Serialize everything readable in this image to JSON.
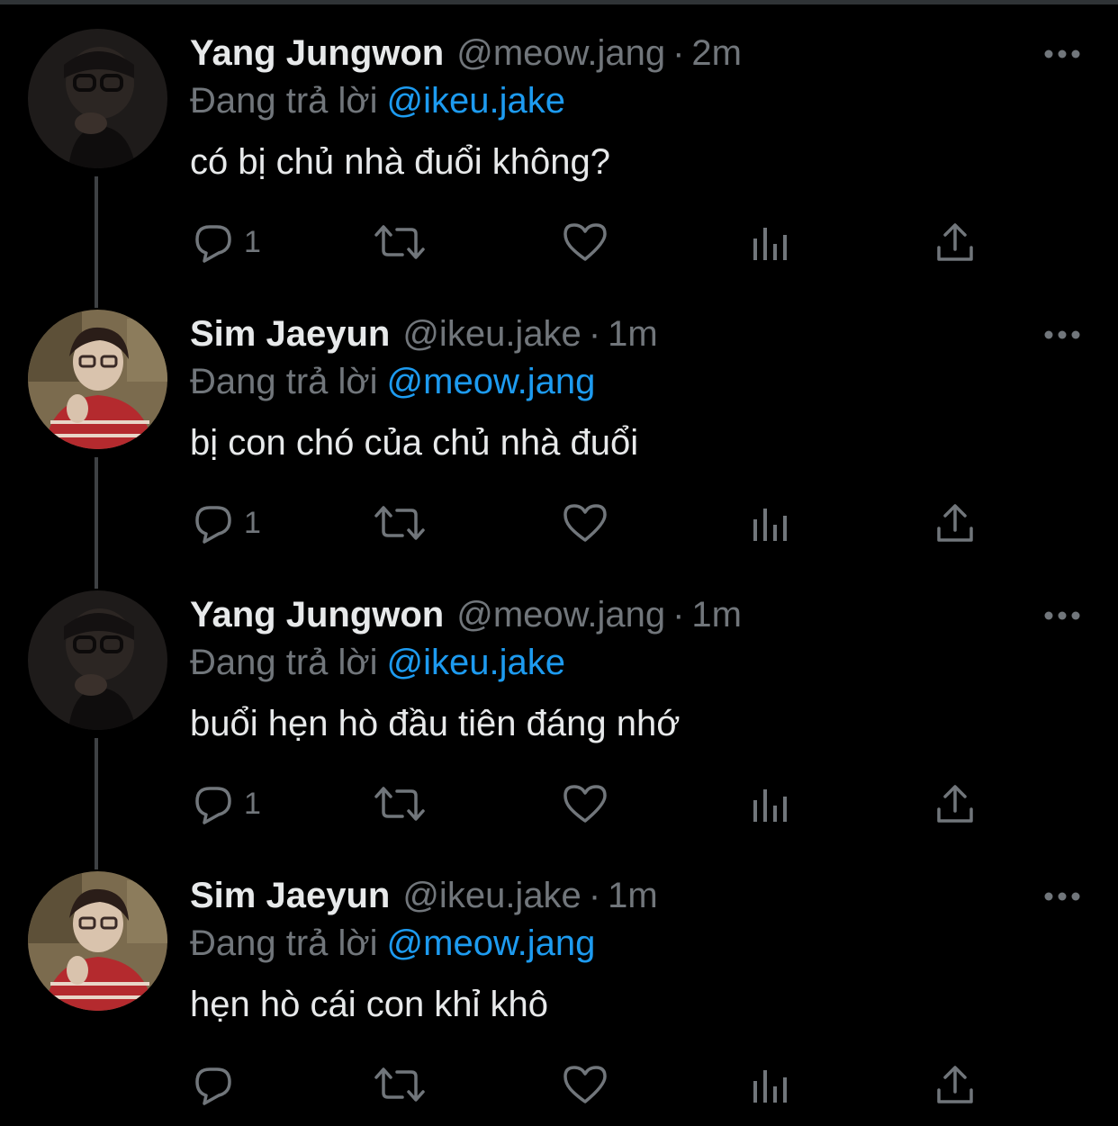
{
  "reply_label": "Đang trả lời",
  "tweets": [
    {
      "name": "Yang Jungwon",
      "handle": "@meow.jang",
      "time": "2m",
      "reply_to": "@ikeu.jake",
      "text": "có bị chủ nhà đuổi không?",
      "reply_count": "1",
      "avatar": "jungwon-avatar"
    },
    {
      "name": "Sim Jaeyun",
      "handle": "@ikeu.jake",
      "time": "1m",
      "reply_to": "@meow.jang",
      "text": "bị con chó của chủ nhà đuổi",
      "reply_count": "1",
      "avatar": "jaeyun-avatar"
    },
    {
      "name": "Yang Jungwon",
      "handle": "@meow.jang",
      "time": "1m",
      "reply_to": "@ikeu.jake",
      "text": "buổi hẹn hò đầu tiên đáng nhớ",
      "reply_count": "1",
      "avatar": "jungwon-avatar"
    },
    {
      "name": "Sim Jaeyun",
      "handle": "@ikeu.jake",
      "time": "1m",
      "reply_to": "@meow.jang",
      "text": "hẹn hò cái con khỉ khô",
      "reply_count": "",
      "avatar": "jaeyun-avatar"
    }
  ],
  "separator": "·",
  "colors": {
    "background": "#000000",
    "text": "#e7e9ea",
    "secondary": "#71767b",
    "mention": "#1d9bf0",
    "thread_line": "#3e4144"
  },
  "icons": {
    "reply": "reply-icon",
    "retweet": "retweet-icon",
    "like": "heart-icon",
    "views": "analytics-icon",
    "share": "share-icon",
    "more": "more-icon"
  }
}
